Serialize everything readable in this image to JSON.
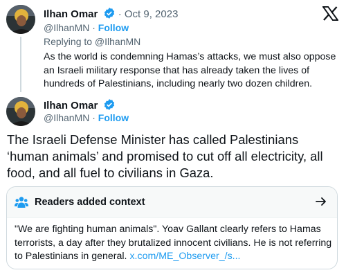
{
  "parent_tweet": {
    "author_name": "Ilhan Omar",
    "date": "· Oct 9, 2023",
    "handle": "@IlhanMN",
    "separator": "·",
    "follow_label": "Follow",
    "replying_to": "Replying to @IlhanMN",
    "text": "As the world is condemning Hamas’s attacks, we must also oppose an Israeli military response that has already taken the lives of hundreds of Palestinians, including nearly two dozen children."
  },
  "main_tweet": {
    "author_name": "Ilhan Omar",
    "handle": "@IlhanMN",
    "separator": "·",
    "follow_label": "Follow",
    "text": "The Israeli Defense Minister has called Palestinians ‘human animals’ and promised to cut off all electricity, all food, and all fuel to civilians in Gaza."
  },
  "context": {
    "title": "Readers added context",
    "body": "\"We are fighting human animals\". Yoav Gallant clearly refers to Hamas terrorists, a day after they brutalized innocent civilians. He is not referring to Palestinians in general.",
    "link": "x.com/ME_Observer_/s..."
  },
  "colors": {
    "accent": "#1d9bf0",
    "muted_text": "#536471",
    "avatar_background": "#1e2a2e"
  },
  "icons": {
    "verified": "verified-badge-icon",
    "logo": "x-logo-icon",
    "context": "people-icon",
    "open": "arrow-right-icon"
  }
}
